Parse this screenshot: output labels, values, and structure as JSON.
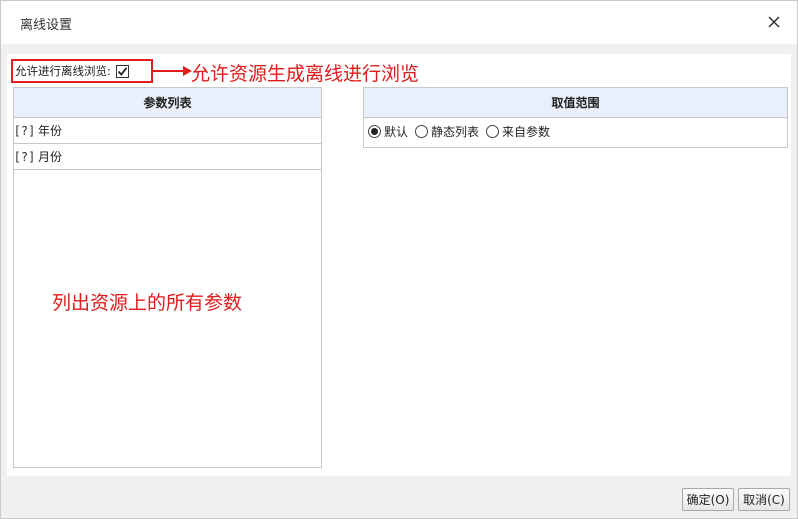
{
  "dialog": {
    "title": "离线设置"
  },
  "offline": {
    "label": "允许进行离线浏览:",
    "checked": true
  },
  "annotations": {
    "top": "允许资源生成离线进行浏览",
    "middle": "列出资源上的所有参数"
  },
  "params": {
    "header": "参数列表",
    "items": [
      {
        "icon": "[?]",
        "label": "年份"
      },
      {
        "icon": "[?]",
        "label": "月份"
      }
    ]
  },
  "range": {
    "header": "取值范围",
    "options": [
      {
        "label": "默认",
        "selected": true
      },
      {
        "label": "静态列表",
        "selected": false
      },
      {
        "label": "来自参数",
        "selected": false
      }
    ]
  },
  "buttons": {
    "ok": "确定(O)",
    "cancel": "取消(C)"
  },
  "colors": {
    "annotation": "#e21b1b",
    "header_bg": "#e9f0fb"
  }
}
